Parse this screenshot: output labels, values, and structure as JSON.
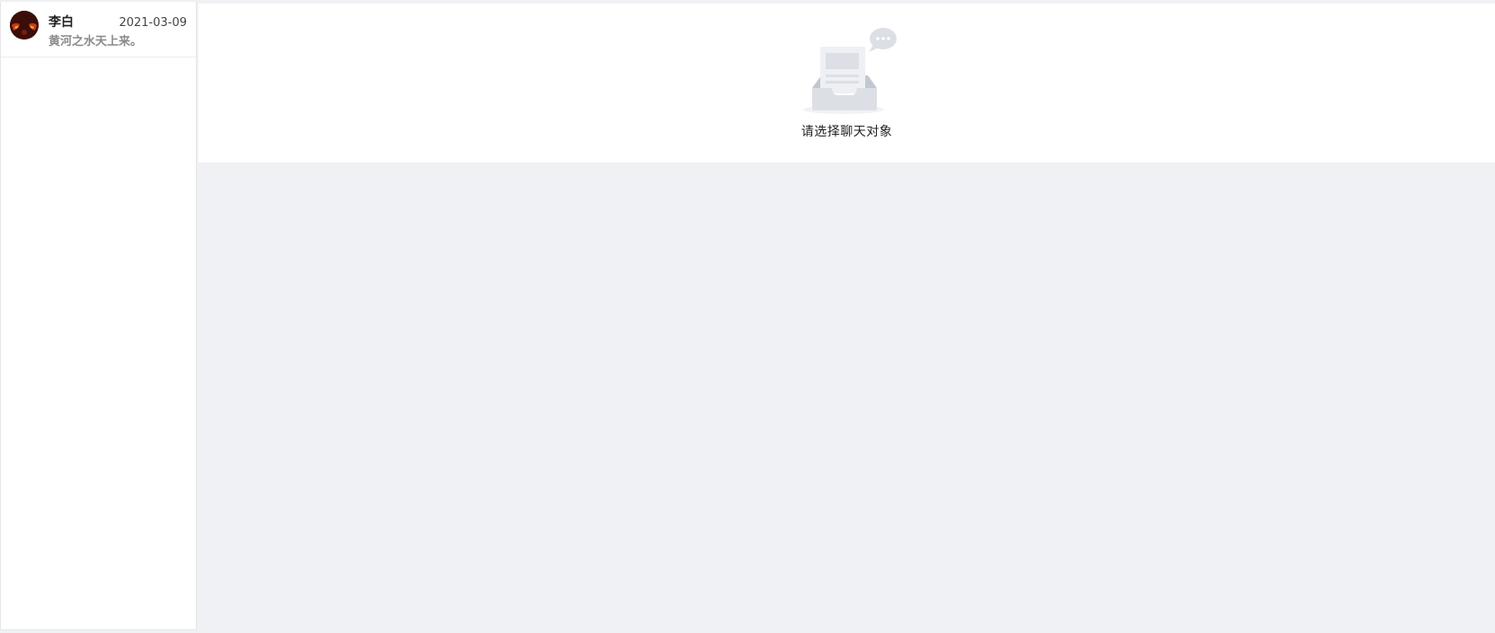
{
  "sidebar": {
    "chats": [
      {
        "name": "李白",
        "date": "2021-03-09",
        "last_message": "黄河之水天上来。",
        "avatar_icon": "avatar-image"
      }
    ]
  },
  "main": {
    "empty_state": {
      "icon": "empty-inbox-icon",
      "text": "请选择聊天对象"
    }
  },
  "colors": {
    "background": "#f0f1f4",
    "panel": "#ffffff",
    "name_text": "#222222",
    "message_text": "#8a8a8a"
  }
}
